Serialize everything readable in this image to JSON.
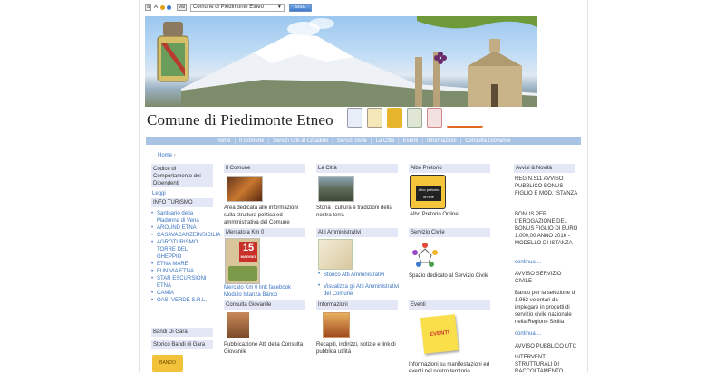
{
  "toolbar": {
    "text_size_small": "a",
    "text_size_large": "A",
    "contrast_label": "Vai",
    "select_value": "Comune di Piedimonte Etneo",
    "badge": "SISC"
  },
  "header": {
    "site_title": "Comune di Piedimonte Etneo"
  },
  "nav": {
    "items": [
      "Home",
      "Il Comune",
      "Servizi Utili al Cittadino",
      "Servizi civile",
      "La Città",
      "Eventi",
      "Informazioni",
      "Consulta Giovanile"
    ]
  },
  "breadcrumb": {
    "home": "Home",
    "sep": "›"
  },
  "sidebar": {
    "codice_title": "Codice di Comportamento dei Dipendenti",
    "leggi": "Leggi",
    "info_turismo": "INFO TURISMO",
    "links": [
      "Santuario della Madonna di Vena",
      "AROUND ETNA",
      "CASAVACANZEINSICILIA",
      "AGROTURISMO TORRE DEL GHEPPIO",
      "ETNA MARE",
      "FUNIVIA ETNA",
      "STAR ESCURSIONI ETNA",
      "CAMIA",
      "OASI VERDE S.R.L."
    ],
    "bandi_gara": "Bandi Di Gara",
    "storico_bandi": "Storico Bandi di Gara",
    "bando_icon_text": "BANDO"
  },
  "blocks": {
    "comune": {
      "title": "Il Comune",
      "text": "Area dedicata alle informazioni sulla struttura politica ed amministrativa del Comune"
    },
    "citta": {
      "title": "La Città",
      "text": "Storia , cultura e tradizioni della nostra terra"
    },
    "albo": {
      "title": "Albo Pretorio",
      "thumb_text": "Albo pretorio on line",
      "text": "Albo Pretorio Online"
    },
    "mercato": {
      "title": "Mercato a Km 0",
      "poster_day": "15",
      "poster_month": "MAGGIO",
      "link1": "Mercato Km 0 link facebook",
      "link2": "Modulo Istanza Banco"
    },
    "atti": {
      "title": "Atti Amministrativi",
      "link1": "Storico Atti Amministrativi",
      "link2": "Visualizza gli Atti Amministrativi del Comune"
    },
    "servizio": {
      "title": "Servizio Civile",
      "text": "Spazio dedicato al Servizio Civile"
    },
    "consulta": {
      "title": "Consulta Giovanile",
      "text": "Pubblicazione Atti della Consulta Giovanile"
    },
    "informazioni": {
      "title": "Informazioni",
      "text": "Recapiti, indirizzi, notizie e link di pubblica utilità"
    },
    "eventi": {
      "title": "Eventi",
      "note_text": "EVENTI",
      "text": "Informazioni su manifestazioni ed eventi nel nostro territorio"
    }
  },
  "news": {
    "title": "Avvisi & Novità",
    "item1": "REG.N.511 AVVISO PUBBLICO BONUS FIGLIO E MOD. ISTANZA",
    "item1b": "BONUS PER L'EROGAZIONE DEL BONUS FIGLIO DI EURO 1.000,00 ANNO 2016 - MODELLO DI ISTANZA",
    "continua1": "continua....",
    "item2": "AVVISO SERVIZIO CIVILE",
    "item2b": "Bando per la selezione di 1.962 volontari da impiegare in progetti di servizio civile nazionale nella Regione Sicilia",
    "continua2": "continua....",
    "item3": "AVVISO PUBBLICO UTC",
    "item3b": "INTERVENTI STRUTTURALI DI RACCOLTAMENTO"
  }
}
